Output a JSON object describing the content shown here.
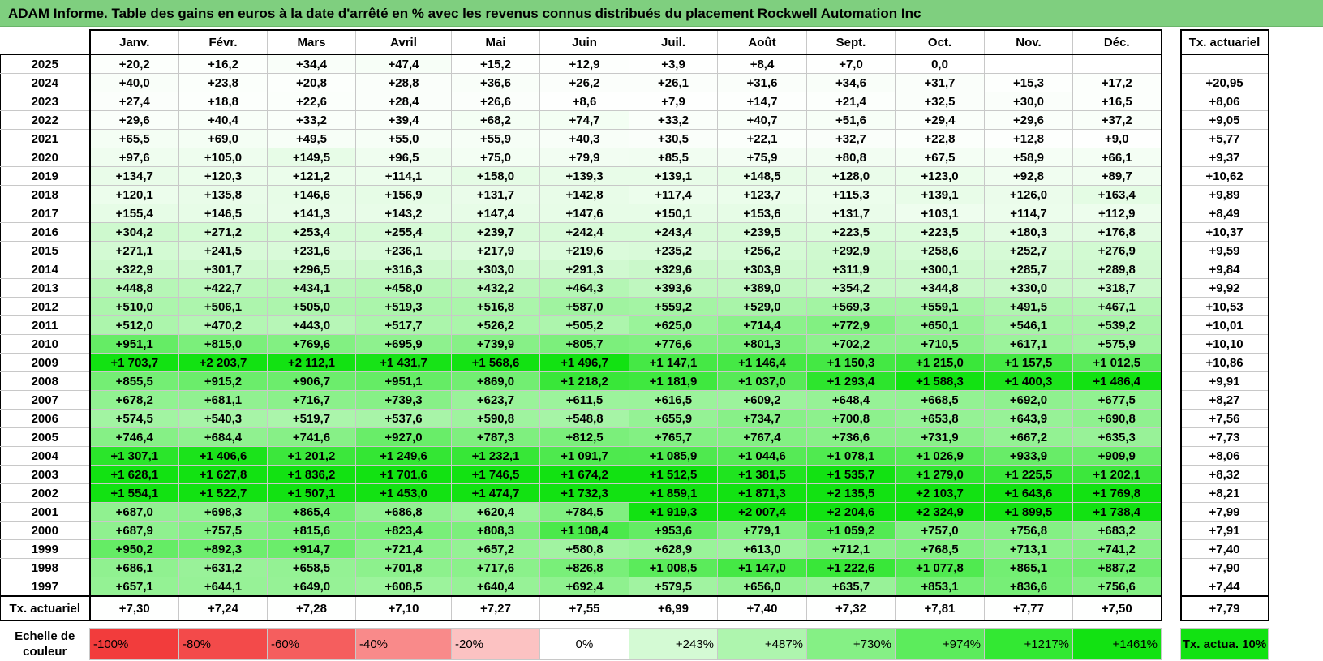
{
  "title": "ADAM Informe. Table des gains en euros à la date d'arrêté en % avec les revenus connus distribués du placement Rockwell Automation Inc",
  "months": [
    "Janv.",
    "Févr.",
    "Mars",
    "Avril",
    "Mai",
    "Juin",
    "Juil.",
    "Août",
    "Sept.",
    "Oct.",
    "Nov.",
    "Déc."
  ],
  "rate_header": "Tx. actuariel",
  "rows": [
    {
      "year": "2025",
      "values": [
        "+20,2",
        "+16,2",
        "+34,4",
        "+47,4",
        "+15,2",
        "+12,9",
        "+3,9",
        "+8,4",
        "+7,0",
        "0,0",
        "",
        ""
      ],
      "rate": ""
    },
    {
      "year": "2024",
      "values": [
        "+40,0",
        "+23,8",
        "+20,8",
        "+28,8",
        "+36,6",
        "+26,2",
        "+26,1",
        "+31,6",
        "+34,6",
        "+31,7",
        "+15,3",
        "+17,2"
      ],
      "rate": "+20,95"
    },
    {
      "year": "2023",
      "values": [
        "+27,4",
        "+18,8",
        "+22,6",
        "+28,4",
        "+26,6",
        "+8,6",
        "+7,9",
        "+14,7",
        "+21,4",
        "+32,5",
        "+30,0",
        "+16,5"
      ],
      "rate": "+8,06"
    },
    {
      "year": "2022",
      "values": [
        "+29,6",
        "+40,4",
        "+33,2",
        "+39,4",
        "+68,2",
        "+74,7",
        "+33,2",
        "+40,7",
        "+51,6",
        "+29,4",
        "+29,6",
        "+37,2"
      ],
      "rate": "+9,05"
    },
    {
      "year": "2021",
      "values": [
        "+65,5",
        "+69,0",
        "+49,5",
        "+55,0",
        "+55,9",
        "+40,3",
        "+30,5",
        "+22,1",
        "+32,7",
        "+22,8",
        "+12,8",
        "+9,0"
      ],
      "rate": "+5,77"
    },
    {
      "year": "2020",
      "values": [
        "+97,6",
        "+105,0",
        "+149,5",
        "+96,5",
        "+75,0",
        "+79,9",
        "+85,5",
        "+75,9",
        "+80,8",
        "+67,5",
        "+58,9",
        "+66,1"
      ],
      "rate": "+9,37"
    },
    {
      "year": "2019",
      "values": [
        "+134,7",
        "+120,3",
        "+121,2",
        "+114,1",
        "+158,0",
        "+139,3",
        "+139,1",
        "+148,5",
        "+128,0",
        "+123,0",
        "+92,8",
        "+89,7"
      ],
      "rate": "+10,62"
    },
    {
      "year": "2018",
      "values": [
        "+120,1",
        "+135,8",
        "+146,6",
        "+156,9",
        "+131,7",
        "+142,8",
        "+117,4",
        "+123,7",
        "+115,3",
        "+139,1",
        "+126,0",
        "+163,4"
      ],
      "rate": "+9,89"
    },
    {
      "year": "2017",
      "values": [
        "+155,4",
        "+146,5",
        "+141,3",
        "+143,2",
        "+147,4",
        "+147,6",
        "+150,1",
        "+153,6",
        "+131,7",
        "+103,1",
        "+114,7",
        "+112,9"
      ],
      "rate": "+8,49"
    },
    {
      "year": "2016",
      "values": [
        "+304,2",
        "+271,2",
        "+253,4",
        "+255,4",
        "+239,7",
        "+242,4",
        "+243,4",
        "+239,5",
        "+223,5",
        "+223,5",
        "+180,3",
        "+176,8"
      ],
      "rate": "+10,37"
    },
    {
      "year": "2015",
      "values": [
        "+271,1",
        "+241,5",
        "+231,6",
        "+236,1",
        "+217,9",
        "+219,6",
        "+235,2",
        "+256,2",
        "+292,9",
        "+258,6",
        "+252,7",
        "+276,9"
      ],
      "rate": "+9,59"
    },
    {
      "year": "2014",
      "values": [
        "+322,9",
        "+301,7",
        "+296,5",
        "+316,3",
        "+303,0",
        "+291,3",
        "+329,6",
        "+303,9",
        "+311,9",
        "+300,1",
        "+285,7",
        "+289,8"
      ],
      "rate": "+9,84"
    },
    {
      "year": "2013",
      "values": [
        "+448,8",
        "+422,7",
        "+434,1",
        "+458,0",
        "+432,2",
        "+464,3",
        "+393,6",
        "+389,0",
        "+354,2",
        "+344,8",
        "+330,0",
        "+318,7"
      ],
      "rate": "+9,92"
    },
    {
      "year": "2012",
      "values": [
        "+510,0",
        "+506,1",
        "+505,0",
        "+519,3",
        "+516,8",
        "+587,0",
        "+559,2",
        "+529,0",
        "+569,3",
        "+559,1",
        "+491,5",
        "+467,1"
      ],
      "rate": "+10,53"
    },
    {
      "year": "2011",
      "values": [
        "+512,0",
        "+470,2",
        "+443,0",
        "+517,7",
        "+526,2",
        "+505,2",
        "+625,0",
        "+714,4",
        "+772,9",
        "+650,1",
        "+546,1",
        "+539,2"
      ],
      "rate": "+10,01"
    },
    {
      "year": "2010",
      "values": [
        "+951,1",
        "+815,0",
        "+769,6",
        "+695,9",
        "+739,9",
        "+805,7",
        "+776,6",
        "+801,3",
        "+702,2",
        "+710,5",
        "+617,1",
        "+575,9"
      ],
      "rate": "+10,10"
    },
    {
      "year": "2009",
      "values": [
        "+1 703,7",
        "+2 203,7",
        "+2 112,1",
        "+1 431,7",
        "+1 568,6",
        "+1 496,7",
        "+1 147,1",
        "+1 146,4",
        "+1 150,3",
        "+1 215,0",
        "+1 157,5",
        "+1 012,5"
      ],
      "rate": "+10,86"
    },
    {
      "year": "2008",
      "values": [
        "+855,5",
        "+915,2",
        "+906,7",
        "+951,1",
        "+869,0",
        "+1 218,2",
        "+1 181,9",
        "+1 037,0",
        "+1 293,4",
        "+1 588,3",
        "+1 400,3",
        "+1 486,4"
      ],
      "rate": "+9,91"
    },
    {
      "year": "2007",
      "values": [
        "+678,2",
        "+681,1",
        "+716,7",
        "+739,3",
        "+623,7",
        "+611,5",
        "+616,5",
        "+609,2",
        "+648,4",
        "+668,5",
        "+692,0",
        "+677,5"
      ],
      "rate": "+8,27"
    },
    {
      "year": "2006",
      "values": [
        "+574,5",
        "+540,3",
        "+519,7",
        "+537,6",
        "+590,8",
        "+548,8",
        "+655,9",
        "+734,7",
        "+700,8",
        "+653,8",
        "+643,9",
        "+690,8"
      ],
      "rate": "+7,56"
    },
    {
      "year": "2005",
      "values": [
        "+746,4",
        "+684,4",
        "+741,6",
        "+927,0",
        "+787,3",
        "+812,5",
        "+765,7",
        "+767,4",
        "+736,6",
        "+731,9",
        "+667,2",
        "+635,3"
      ],
      "rate": "+7,73"
    },
    {
      "year": "2004",
      "values": [
        "+1 307,1",
        "+1 406,6",
        "+1 201,2",
        "+1 249,6",
        "+1 232,1",
        "+1 091,7",
        "+1 085,9",
        "+1 044,6",
        "+1 078,1",
        "+1 026,9",
        "+933,9",
        "+909,9"
      ],
      "rate": "+8,06"
    },
    {
      "year": "2003",
      "values": [
        "+1 628,1",
        "+1 627,8",
        "+1 836,2",
        "+1 701,6",
        "+1 746,5",
        "+1 674,2",
        "+1 512,5",
        "+1 381,5",
        "+1 535,7",
        "+1 279,0",
        "+1 225,5",
        "+1 202,1"
      ],
      "rate": "+8,32"
    },
    {
      "year": "2002",
      "values": [
        "+1 554,1",
        "+1 522,7",
        "+1 507,1",
        "+1 453,0",
        "+1 474,7",
        "+1 732,3",
        "+1 859,1",
        "+1 871,3",
        "+2 135,5",
        "+2 103,7",
        "+1 643,6",
        "+1 769,8"
      ],
      "rate": "+8,21"
    },
    {
      "year": "2001",
      "values": [
        "+687,0",
        "+698,3",
        "+865,4",
        "+686,8",
        "+620,4",
        "+784,5",
        "+1 919,3",
        "+2 007,4",
        "+2 204,6",
        "+2 324,9",
        "+1 899,5",
        "+1 738,4"
      ],
      "rate": "+7,99"
    },
    {
      "year": "2000",
      "values": [
        "+687,9",
        "+757,5",
        "+815,6",
        "+823,4",
        "+808,3",
        "+1 108,4",
        "+953,6",
        "+779,1",
        "+1 059,2",
        "+757,0",
        "+756,8",
        "+683,2"
      ],
      "rate": "+7,91"
    },
    {
      "year": "1999",
      "values": [
        "+950,2",
        "+892,3",
        "+914,7",
        "+721,4",
        "+657,2",
        "+580,8",
        "+628,9",
        "+613,0",
        "+712,1",
        "+768,5",
        "+713,1",
        "+741,2"
      ],
      "rate": "+7,40"
    },
    {
      "year": "1998",
      "values": [
        "+686,1",
        "+631,2",
        "+658,5",
        "+701,8",
        "+717,6",
        "+826,8",
        "+1 008,5",
        "+1 147,0",
        "+1 222,6",
        "+1 077,8",
        "+865,1",
        "+887,2"
      ],
      "rate": "+7,90"
    },
    {
      "year": "1997",
      "values": [
        "+657,1",
        "+644,1",
        "+649,0",
        "+608,5",
        "+640,4",
        "+692,4",
        "+579,5",
        "+656,0",
        "+635,7",
        "+853,1",
        "+836,6",
        "+756,6"
      ],
      "rate": "+7,44"
    }
  ],
  "summary": {
    "label": "Tx. actuariel",
    "values": [
      "+7,30",
      "+7,24",
      "+7,28",
      "+7,10",
      "+7,27",
      "+7,55",
      "+6,99",
      "+7,40",
      "+7,32",
      "+7,81",
      "+7,77",
      "+7,50"
    ],
    "rate": "+7,79"
  },
  "legend": {
    "label": "Echelle de couleur",
    "steps": [
      {
        "text": "-100%",
        "color": "#f23c3c"
      },
      {
        "text": "-80%",
        "color": "#f34a4a"
      },
      {
        "text": "-60%",
        "color": "#f55e5e"
      },
      {
        "text": "-40%",
        "color": "#f98a8a"
      },
      {
        "text": "-20%",
        "color": "#fcc2c2"
      },
      {
        "text": "0%",
        "color": "#ffffff"
      },
      {
        "text": "+243%",
        "color": "#d4fad4"
      },
      {
        "text": "+487%",
        "color": "#aef5ae"
      },
      {
        "text": "+730%",
        "color": "#85f085"
      },
      {
        "text": "+974%",
        "color": "#5cec5c"
      },
      {
        "text": "+1217%",
        "color": "#33e833"
      },
      {
        "text": "+1461%",
        "color": "#12e212"
      }
    ],
    "reference": {
      "text": "Tx. actua. 10%",
      "color": "#12e212"
    }
  },
  "scale_max": 1461
}
